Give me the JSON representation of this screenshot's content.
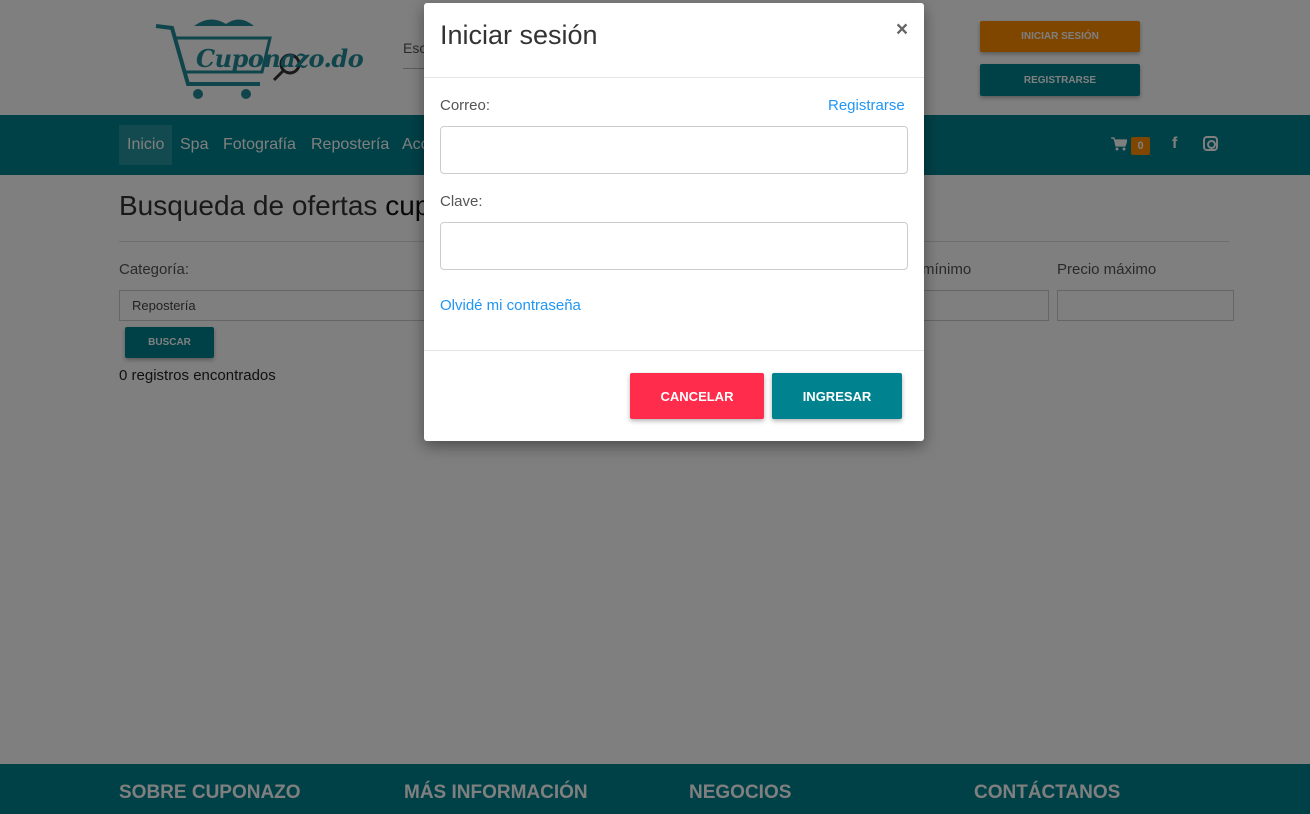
{
  "header": {
    "logo_text": "Cuponazo.do",
    "search_stub": "Esc",
    "login_button": "INICIAR SESIÓN",
    "register_button": "REGISTRARSE"
  },
  "nav": {
    "items": [
      "Inicio",
      "Spa",
      "Fotografía",
      "Repostería",
      "Acc"
    ],
    "cart_count": "0",
    "facebook_glyph": "f"
  },
  "main": {
    "title_prefix": "Busqueda de ofertas",
    "title_bold": "cup",
    "category_label": "Categoría:",
    "category_value": "Repostería",
    "min_price_label": "mínimo",
    "max_price_label": "Precio máximo",
    "search_button": "BUSCAR",
    "records_text": "0 registros encontrados"
  },
  "footer": {
    "headings": [
      "SOBRE CUPONAZO",
      "MÁS INFORMACIÓN",
      "NEGOCIOS",
      "CONTÁCTANOS"
    ]
  },
  "modal": {
    "title": "Iniciar sesión",
    "close_glyph": "×",
    "email_label": "Correo:",
    "register_link": "Registrarse",
    "password_label": "Clave:",
    "forgot_link": "Olvidé mi contraseña",
    "cancel_button": "CANCELAR",
    "submit_button": "INGRESAR"
  },
  "colors": {
    "brand_teal": "#00838f",
    "accent_orange": "#ff8c00",
    "cancel_red": "#ff2d4b",
    "link_blue": "#2196f3"
  },
  "icons": [
    "cart-icon",
    "facebook-icon",
    "instagram-icon",
    "close-icon"
  ]
}
